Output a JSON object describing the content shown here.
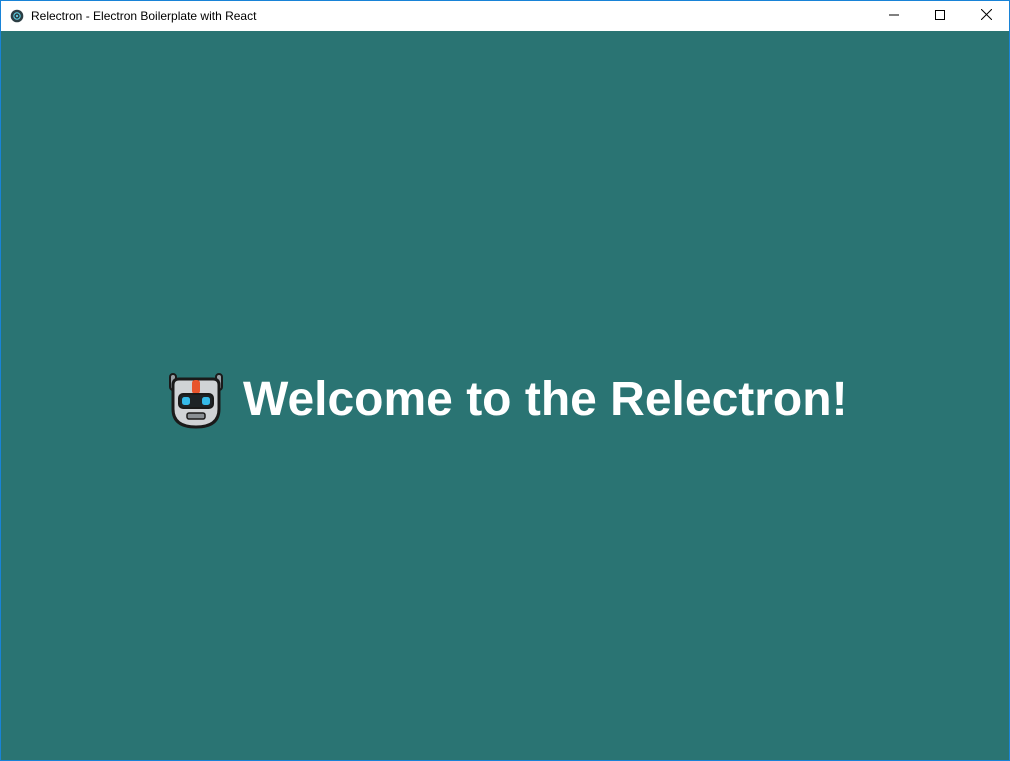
{
  "window": {
    "title": "Relectron - Electron Boilerplate with React",
    "app_icon": "electron-atom-icon",
    "controls": {
      "minimize_icon": "minimize-icon",
      "maximize_icon": "maximize-icon",
      "close_icon": "close-icon"
    }
  },
  "main": {
    "emoji_icon": "robot-face-icon",
    "heading": "Welcome to the Relectron!"
  },
  "colors": {
    "background": "#2a7473",
    "heading_text": "#ffffff",
    "titlebar": "#ffffff",
    "window_border": "#1883d7"
  }
}
